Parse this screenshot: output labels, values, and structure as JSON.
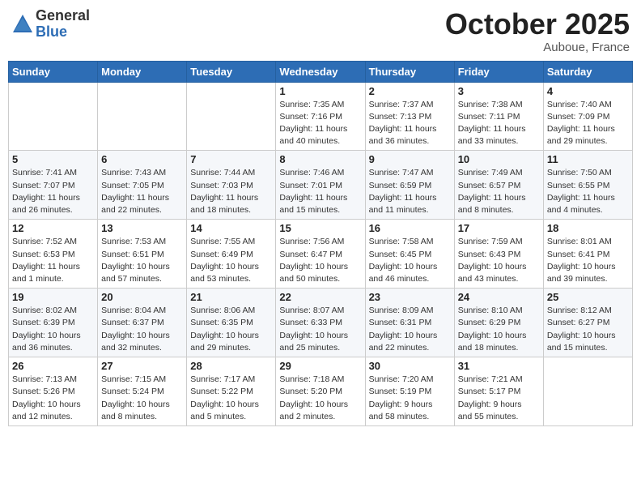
{
  "header": {
    "logo_general": "General",
    "logo_blue": "Blue",
    "month_title": "October 2025",
    "location": "Auboue, France"
  },
  "weekdays": [
    "Sunday",
    "Monday",
    "Tuesday",
    "Wednesday",
    "Thursday",
    "Friday",
    "Saturday"
  ],
  "weeks": [
    [
      {
        "day": "",
        "info": ""
      },
      {
        "day": "",
        "info": ""
      },
      {
        "day": "",
        "info": ""
      },
      {
        "day": "1",
        "info": "Sunrise: 7:35 AM\nSunset: 7:16 PM\nDaylight: 11 hours\nand 40 minutes."
      },
      {
        "day": "2",
        "info": "Sunrise: 7:37 AM\nSunset: 7:13 PM\nDaylight: 11 hours\nand 36 minutes."
      },
      {
        "day": "3",
        "info": "Sunrise: 7:38 AM\nSunset: 7:11 PM\nDaylight: 11 hours\nand 33 minutes."
      },
      {
        "day": "4",
        "info": "Sunrise: 7:40 AM\nSunset: 7:09 PM\nDaylight: 11 hours\nand 29 minutes."
      }
    ],
    [
      {
        "day": "5",
        "info": "Sunrise: 7:41 AM\nSunset: 7:07 PM\nDaylight: 11 hours\nand 26 minutes."
      },
      {
        "day": "6",
        "info": "Sunrise: 7:43 AM\nSunset: 7:05 PM\nDaylight: 11 hours\nand 22 minutes."
      },
      {
        "day": "7",
        "info": "Sunrise: 7:44 AM\nSunset: 7:03 PM\nDaylight: 11 hours\nand 18 minutes."
      },
      {
        "day": "8",
        "info": "Sunrise: 7:46 AM\nSunset: 7:01 PM\nDaylight: 11 hours\nand 15 minutes."
      },
      {
        "day": "9",
        "info": "Sunrise: 7:47 AM\nSunset: 6:59 PM\nDaylight: 11 hours\nand 11 minutes."
      },
      {
        "day": "10",
        "info": "Sunrise: 7:49 AM\nSunset: 6:57 PM\nDaylight: 11 hours\nand 8 minutes."
      },
      {
        "day": "11",
        "info": "Sunrise: 7:50 AM\nSunset: 6:55 PM\nDaylight: 11 hours\nand 4 minutes."
      }
    ],
    [
      {
        "day": "12",
        "info": "Sunrise: 7:52 AM\nSunset: 6:53 PM\nDaylight: 11 hours\nand 1 minute."
      },
      {
        "day": "13",
        "info": "Sunrise: 7:53 AM\nSunset: 6:51 PM\nDaylight: 10 hours\nand 57 minutes."
      },
      {
        "day": "14",
        "info": "Sunrise: 7:55 AM\nSunset: 6:49 PM\nDaylight: 10 hours\nand 53 minutes."
      },
      {
        "day": "15",
        "info": "Sunrise: 7:56 AM\nSunset: 6:47 PM\nDaylight: 10 hours\nand 50 minutes."
      },
      {
        "day": "16",
        "info": "Sunrise: 7:58 AM\nSunset: 6:45 PM\nDaylight: 10 hours\nand 46 minutes."
      },
      {
        "day": "17",
        "info": "Sunrise: 7:59 AM\nSunset: 6:43 PM\nDaylight: 10 hours\nand 43 minutes."
      },
      {
        "day": "18",
        "info": "Sunrise: 8:01 AM\nSunset: 6:41 PM\nDaylight: 10 hours\nand 39 minutes."
      }
    ],
    [
      {
        "day": "19",
        "info": "Sunrise: 8:02 AM\nSunset: 6:39 PM\nDaylight: 10 hours\nand 36 minutes."
      },
      {
        "day": "20",
        "info": "Sunrise: 8:04 AM\nSunset: 6:37 PM\nDaylight: 10 hours\nand 32 minutes."
      },
      {
        "day": "21",
        "info": "Sunrise: 8:06 AM\nSunset: 6:35 PM\nDaylight: 10 hours\nand 29 minutes."
      },
      {
        "day": "22",
        "info": "Sunrise: 8:07 AM\nSunset: 6:33 PM\nDaylight: 10 hours\nand 25 minutes."
      },
      {
        "day": "23",
        "info": "Sunrise: 8:09 AM\nSunset: 6:31 PM\nDaylight: 10 hours\nand 22 minutes."
      },
      {
        "day": "24",
        "info": "Sunrise: 8:10 AM\nSunset: 6:29 PM\nDaylight: 10 hours\nand 18 minutes."
      },
      {
        "day": "25",
        "info": "Sunrise: 8:12 AM\nSunset: 6:27 PM\nDaylight: 10 hours\nand 15 minutes."
      }
    ],
    [
      {
        "day": "26",
        "info": "Sunrise: 7:13 AM\nSunset: 5:26 PM\nDaylight: 10 hours\nand 12 minutes."
      },
      {
        "day": "27",
        "info": "Sunrise: 7:15 AM\nSunset: 5:24 PM\nDaylight: 10 hours\nand 8 minutes."
      },
      {
        "day": "28",
        "info": "Sunrise: 7:17 AM\nSunset: 5:22 PM\nDaylight: 10 hours\nand 5 minutes."
      },
      {
        "day": "29",
        "info": "Sunrise: 7:18 AM\nSunset: 5:20 PM\nDaylight: 10 hours\nand 2 minutes."
      },
      {
        "day": "30",
        "info": "Sunrise: 7:20 AM\nSunset: 5:19 PM\nDaylight: 9 hours\nand 58 minutes."
      },
      {
        "day": "31",
        "info": "Sunrise: 7:21 AM\nSunset: 5:17 PM\nDaylight: 9 hours\nand 55 minutes."
      },
      {
        "day": "",
        "info": ""
      }
    ]
  ]
}
